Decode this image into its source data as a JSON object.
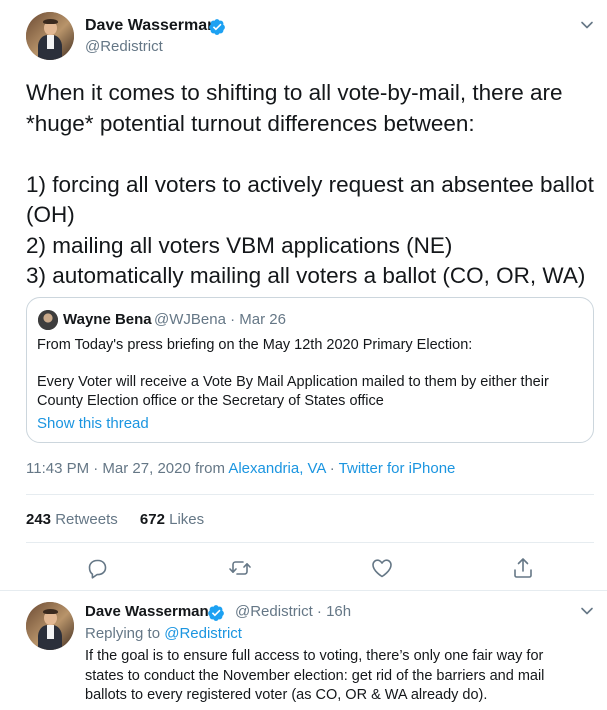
{
  "main_tweet": {
    "author_name": "Dave Wasserman",
    "author_handle": "@Redistrict",
    "text": "When it comes to shifting to all vote-by-mail, there are *huge* potential turnout differences between:\n\n1) forcing all voters to actively request an absentee ballot (OH)\n2) mailing all voters VBM applications (NE)\n3) automatically mailing all voters a ballot (CO, OR, WA)",
    "timestamp": "11:43 PM · Mar 27, 2020 from ",
    "location": "Alexandria, VA",
    "separator": " · ",
    "source": "Twitter for iPhone"
  },
  "quoted_tweet": {
    "author_name": "Wayne Bena",
    "author_handle_date": "@WJBena · Mar 26",
    "text": "From Today's press briefing on the May 12th 2020 Primary Election:\n\nEvery Voter will receive a Vote By Mail Application mailed to them by either their County Election office or the Secretary of States office",
    "show_thread_label": "Show this thread"
  },
  "stats": {
    "retweets_count": "243",
    "retweets_label": "Retweets",
    "likes_count": "672",
    "likes_label": "Likes"
  },
  "reply_tweet": {
    "author_name": "Dave Wasserman",
    "author_handle_time": "@Redistrict · 16h",
    "replying_prefix": "Replying to ",
    "replying_to": "@Redistrict",
    "text": "If the goal is to ensure full access to voting, there’s only one fair way for states to conduct the November election: get rid of the barriers and mail ballots to every registered voter (as CO, OR & WA already do)."
  },
  "icons": {
    "verified": "verified-badge-icon",
    "menu": "chevron-down-icon",
    "reply": "reply-icon",
    "retweet": "retweet-icon",
    "like": "heart-icon",
    "share": "share-icon"
  },
  "colors": {
    "link": "#1b95e0",
    "verified": "#1da1f2",
    "muted": "#657786",
    "text": "#14171a"
  }
}
